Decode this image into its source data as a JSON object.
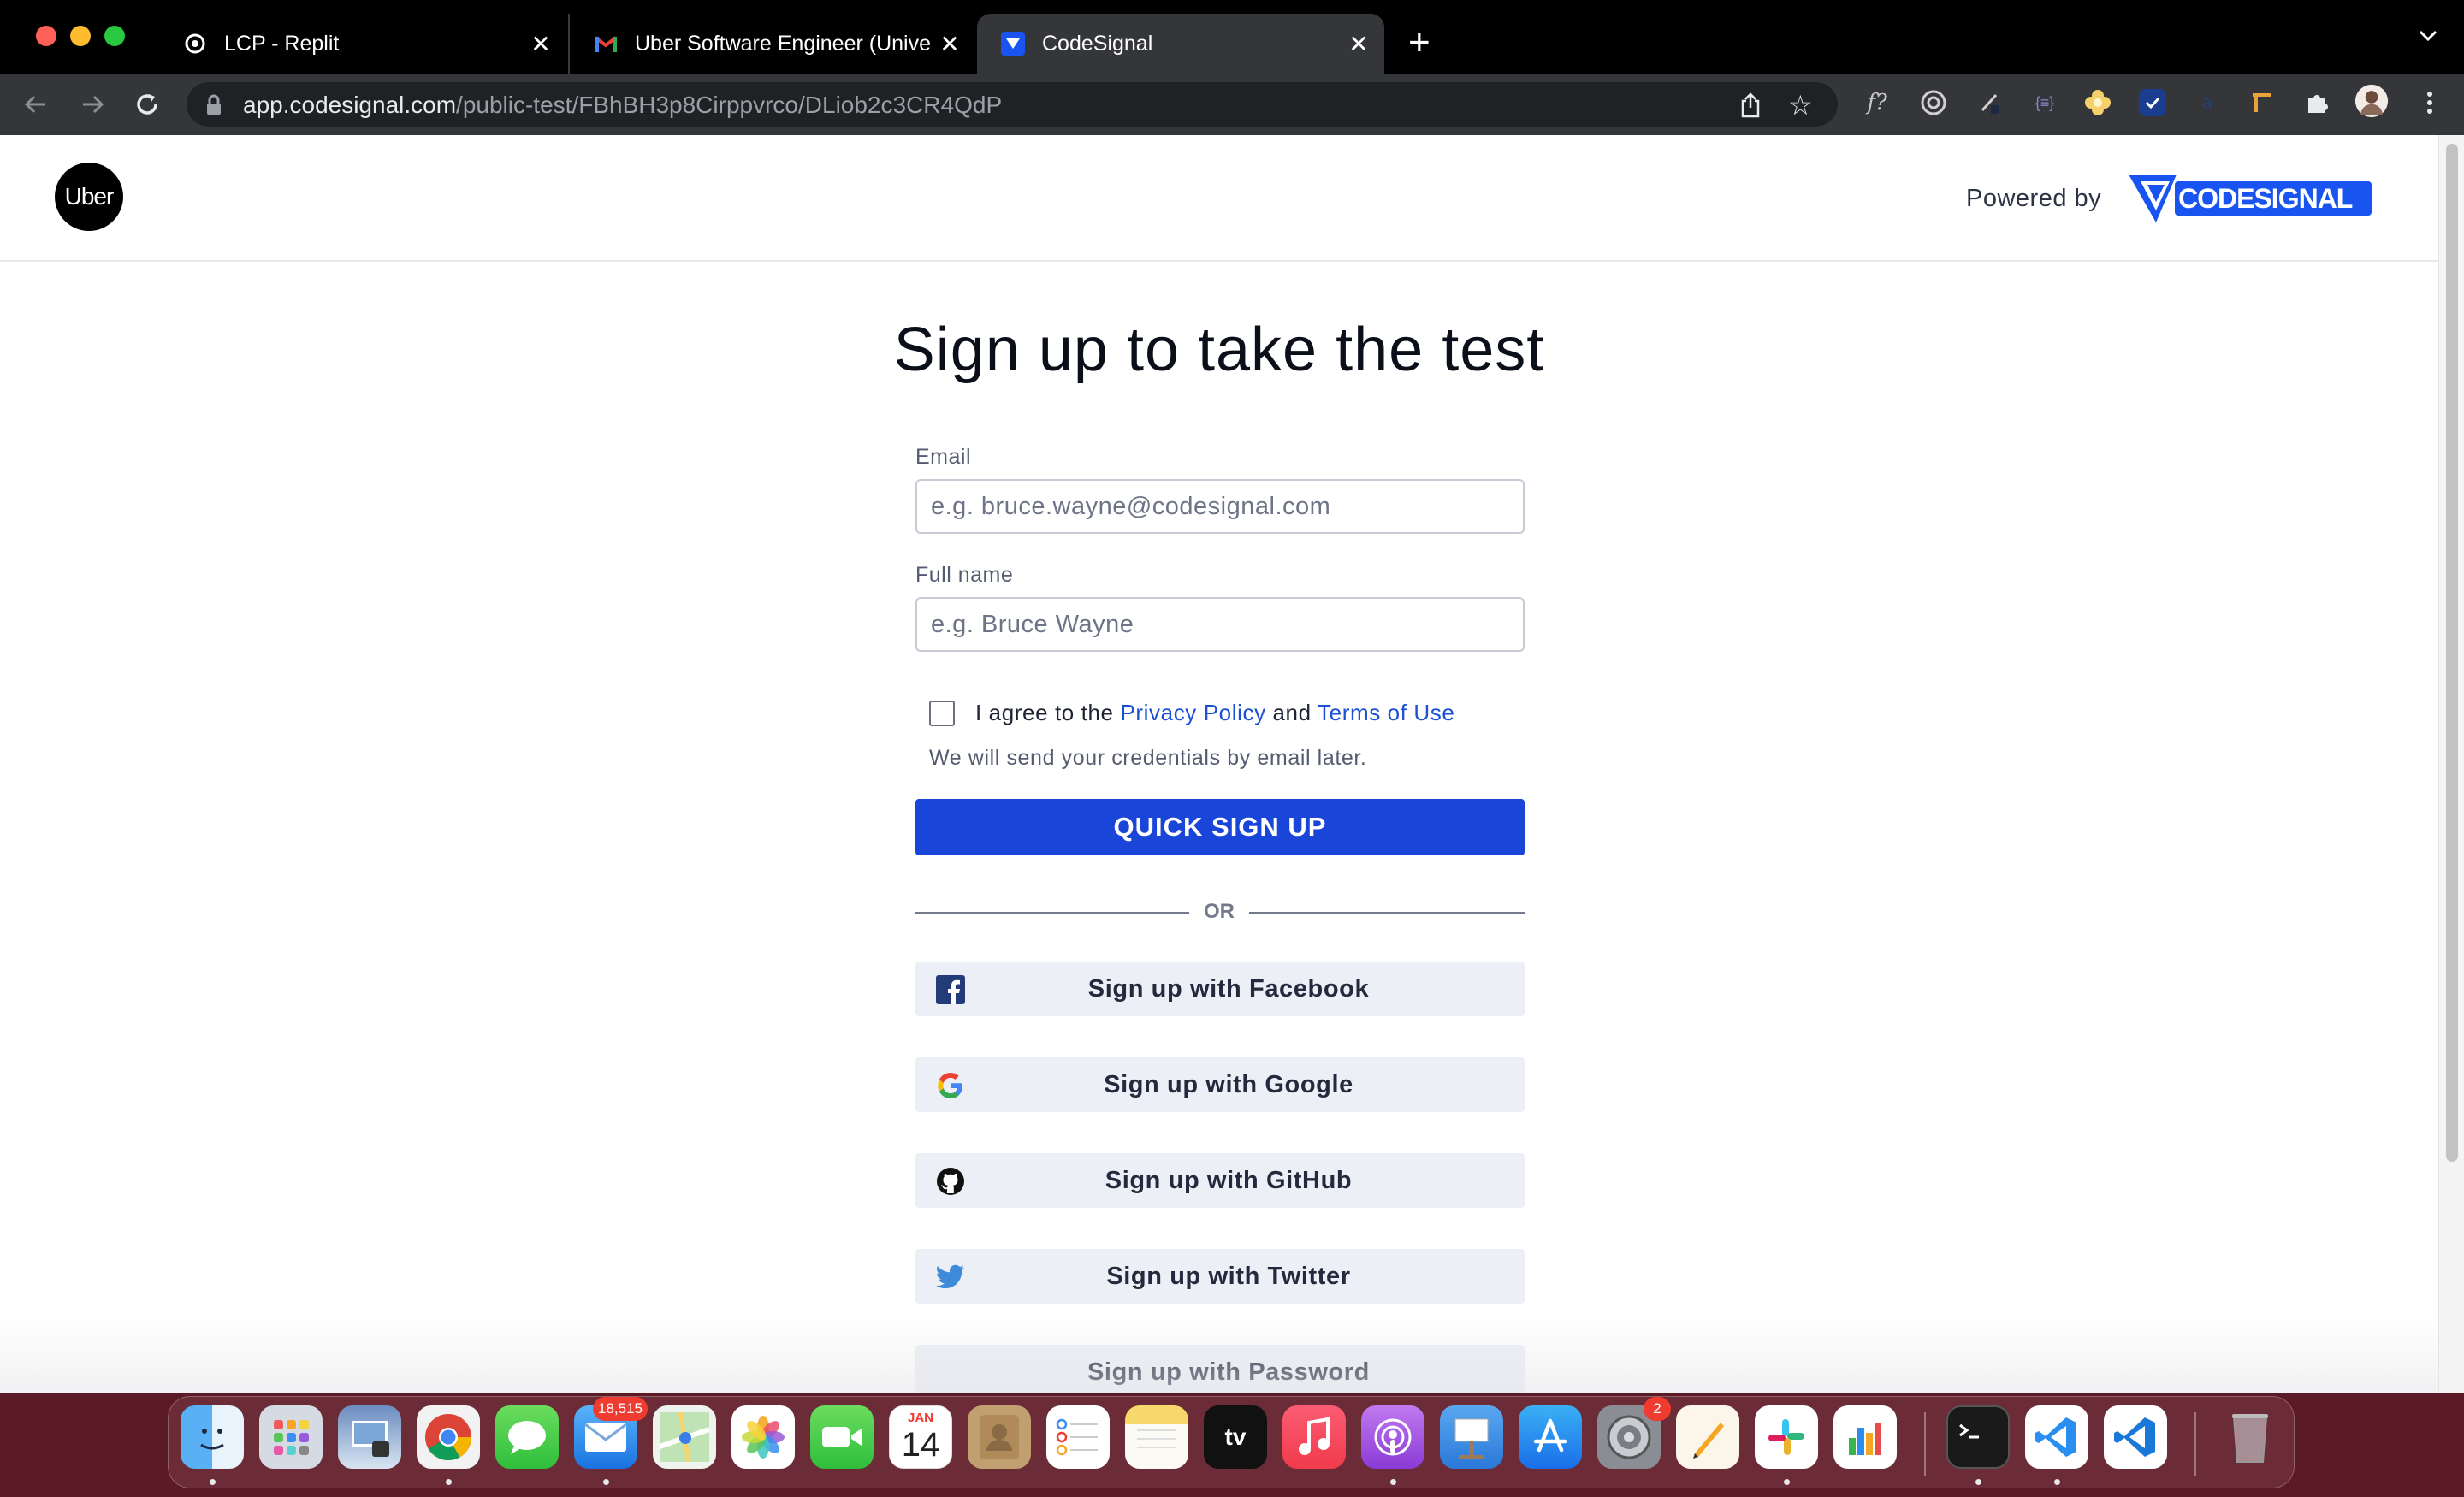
{
  "browser": {
    "tabs": [
      {
        "title": "LCP - Replit",
        "close": "✕"
      },
      {
        "title": "Uber Software Engineer (Unive",
        "close": "✕"
      },
      {
        "title": "CodeSignal",
        "close": "✕"
      }
    ],
    "new_tab": "+",
    "address": {
      "host": "app.codesignal.com",
      "path": "/public-test/FBhBH3p8Cirppvrco/DLiob2c3CR4QdP"
    },
    "extensions": [
      "f?",
      "target-icon",
      "pen-icon",
      "{≡}",
      "flower-icon",
      "check-icon",
      "a",
      "ruler-icon",
      "puzzle-icon",
      "avatar",
      "menu-icon"
    ]
  },
  "header": {
    "brand_logo": "Uber",
    "powered_by": "Powered by",
    "partner_logo": "CODESIGNAL"
  },
  "form": {
    "title": "Sign up to take the test",
    "email_label": "Email",
    "email_placeholder": "e.g. bruce.wayne@codesignal.com",
    "email_value": "",
    "name_label": "Full name",
    "name_placeholder": "e.g. Bruce Wayne",
    "name_value": "",
    "agree_prefix": "I agree to the ",
    "privacy_link": "Privacy Policy",
    "agree_and": " and ",
    "terms_link": "Terms of Use",
    "agree_checked": false,
    "credentials_note": "We will send your credentials by email later.",
    "quick_signup": "QUICK SIGN UP",
    "or": "OR",
    "social": [
      {
        "label": "Sign up with Facebook",
        "icon": "facebook-icon"
      },
      {
        "label": "Sign up with Google",
        "icon": "google-icon"
      },
      {
        "label": "Sign up with GitHub",
        "icon": "github-icon"
      },
      {
        "label": "Sign up with Twitter",
        "icon": "twitter-icon"
      },
      {
        "label": "Sign up with Password",
        "icon": "none"
      }
    ]
  },
  "dock": {
    "mail_badge": "18,515",
    "calendar_month": "JAN",
    "calendar_day": "14",
    "settings_badge": "2",
    "tv_label": "tv"
  },
  "colors": {
    "accent": "#1a45d9",
    "link": "#1a4fd6",
    "social_bg": "#eceff6"
  }
}
